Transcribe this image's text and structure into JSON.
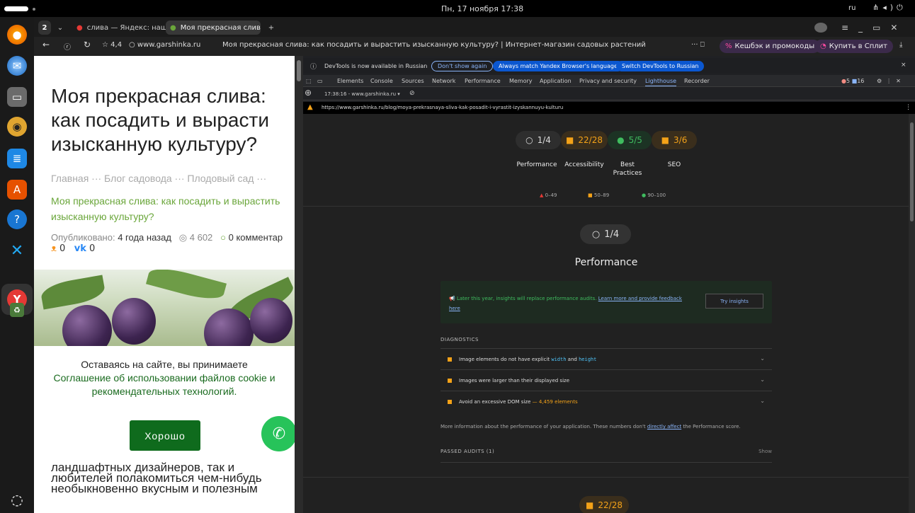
{
  "topbar": {
    "clock": "Пн, 17 ноября  17:38",
    "lang": "ru"
  },
  "tabs": [
    {
      "label": "слива — Яндекс: нашлос"
    },
    {
      "label": "Моя прекрасная слива"
    },
    {
      "count": "2"
    }
  ],
  "addr": {
    "rating": "4,4",
    "domain": "www.garshinka.ru",
    "page_title": "Моя прекрасная слива: как посадить и вырастить изысканную культуру? | Интернет-магазин садовых растений",
    "cashback": "Кешбэк и промокоды",
    "split": "Купить в Сплит"
  },
  "page": {
    "title_lines": [
      "Моя прекрасная слива:",
      "как посадить и вырасти",
      "изысканную культуру?"
    ],
    "crumbs": "Главная  ···  Блог садовода  ···  Плодовый сад  ···",
    "crumb_current": "Моя прекрасная слива: как посадить и вырастить изысканную культуру?",
    "published_label": "Опубликовано:",
    "published_value": "4 года назад",
    "views": "4 602",
    "comments": "0 комментар",
    "ok_count": "0",
    "vk_count": "0",
    "cookie_line1": "Оставаясь на сайте, вы принимаете",
    "cookie_link": "Соглашение об использовании файлов cookie и рекомендательных технологий.",
    "ok_button": "Хорошо",
    "tail_lines": [
      "ландшафтных дизайнеров, так и",
      "любителей полакомиться чем-нибудь",
      "необыкновенно вкусным и полезным"
    ]
  },
  "devtools": {
    "info_text": "DevTools is now available in Russian",
    "btn_dont_show": "Don't show again",
    "btn_match": "Always match Yandex Browser's language",
    "btn_switch": "Switch DevTools to Russian",
    "tabs": [
      "Elements",
      "Console",
      "Sources",
      "Network",
      "Performance",
      "Memory",
      "Application",
      "Privacy and security",
      "Lighthouse",
      "Recorder"
    ],
    "errors": "5",
    "issues": "16",
    "session": "17:38:16 - www.garshinka.ru",
    "url": "https://www.garshinka.ru/blog/moya-prekrasnaya-sliva-kak-posadit-i-vyrastit-izyskannuyu-kulturu",
    "scores": [
      {
        "value": "1/4",
        "label": "Performance"
      },
      {
        "value": "22/28",
        "label": "Accessibility"
      },
      {
        "value": "5/5",
        "label": "Best Practices"
      },
      {
        "value": "3/6",
        "label": "SEO"
      }
    ],
    "legend": [
      "0–49",
      "50–89",
      "90–100"
    ],
    "perf_score": "1/4",
    "perf_title": "Performance",
    "insight_text": "Later this year, insights will replace performance audits.",
    "insight_link": "Learn more and provide feedback",
    "insight_link2": "here",
    "insight_button": "Try insights",
    "diagnostics": "DIAGNOSTICS",
    "audit1_pre": "Image elements do not have explicit",
    "audit1_code1": "width",
    "audit1_and": "and",
    "audit1_code2": "height",
    "audit2": "Images were larger than their displayed size",
    "audit3": "Avoid an excessive DOM size",
    "audit3_value": "— 4,459 elements",
    "more_info_pre": "More information about the performance of your application. These numbers don't",
    "more_info_link": "directly affect",
    "more_info_post": "the Performance score.",
    "passed": "PASSED AUDITS (1)",
    "show": "Show",
    "bottom_score": "22/28"
  }
}
